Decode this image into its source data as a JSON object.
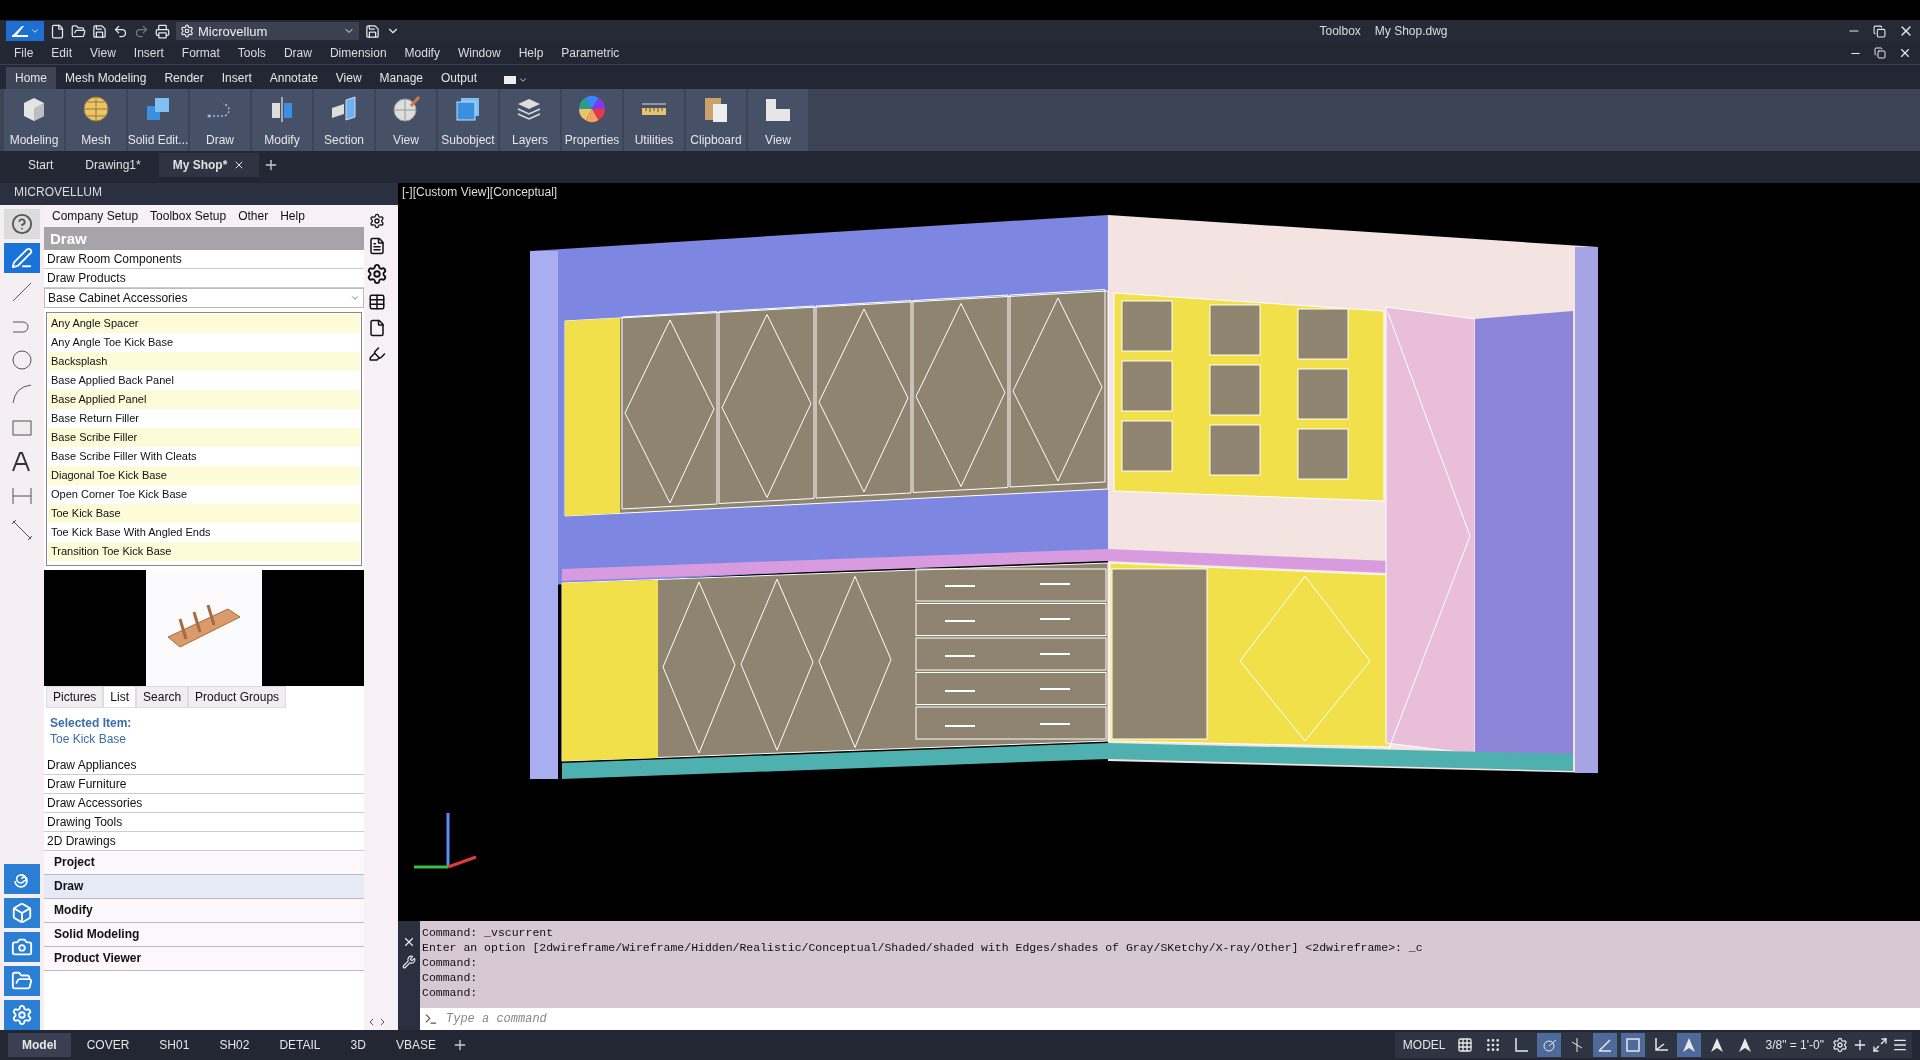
{
  "quick_access": {
    "workspace": "Microvellum"
  },
  "title_bar": {
    "items": [
      "Toolbox",
      "My Shop.dwg"
    ]
  },
  "menu_bar": [
    "File",
    "Edit",
    "View",
    "Insert",
    "Format",
    "Tools",
    "Draw",
    "Dimension",
    "Modify",
    "Window",
    "Help",
    "Parametric"
  ],
  "ribbon_tabs": [
    {
      "label": "Home",
      "selected": true
    },
    {
      "label": "Mesh Modeling",
      "selected": false
    },
    {
      "label": "Render",
      "selected": false
    },
    {
      "label": "Insert",
      "selected": false
    },
    {
      "label": "Annotate",
      "selected": false
    },
    {
      "label": "View",
      "selected": false
    },
    {
      "label": "Manage",
      "selected": false
    },
    {
      "label": "Output",
      "selected": false
    }
  ],
  "ribbon_buttons": [
    {
      "label": "Modeling",
      "kind": "box"
    },
    {
      "label": "Mesh",
      "kind": "sphere"
    },
    {
      "label": "Solid Edit...",
      "kind": "solids"
    },
    {
      "label": "Draw",
      "kind": "curve"
    },
    {
      "label": "Modify",
      "kind": "mirror"
    },
    {
      "label": "Section",
      "kind": "section"
    },
    {
      "label": "View",
      "kind": "globe"
    },
    {
      "label": "Subobject",
      "kind": "cube"
    },
    {
      "label": "Layers",
      "kind": "layers"
    },
    {
      "label": "Properties",
      "kind": "wheel"
    },
    {
      "label": "Utilities",
      "kind": "ruler"
    },
    {
      "label": "Clipboard",
      "kind": "clipboard"
    },
    {
      "label": "View",
      "kind": "lshape"
    }
  ],
  "file_tabs": [
    {
      "label": "Start",
      "selected": false
    },
    {
      "label": "Drawing1*",
      "selected": false
    },
    {
      "label": "My Shop*",
      "selected": true
    }
  ],
  "palette": {
    "title": "MICROVELLUM",
    "menu": [
      "Company Setup",
      "Toolbox Setup",
      "Other",
      "Help"
    ],
    "section_title": "Draw",
    "links": [
      "Draw Room Components",
      "Draw Products"
    ],
    "category": "Base Cabinet Accessories",
    "items": [
      "Any Angle Spacer",
      "Any Angle Toe Kick Base",
      "Backsplash",
      "Base Applied Back Panel",
      "Base Applied Panel",
      "Base Return Filler",
      "Base Scribe Filler",
      "Base Scribe Filler With Cleats",
      "Diagonal Toe Kick Base",
      "Open Corner Toe Kick Base",
      "Toe Kick Base",
      "Toe Kick Base With Angled Ends",
      "Transition Toe Kick Base"
    ],
    "view_tabs": [
      {
        "label": "Pictures",
        "selected": false
      },
      {
        "label": "List",
        "selected": true
      },
      {
        "label": "Search",
        "selected": false
      },
      {
        "label": "Product Groups",
        "selected": false
      }
    ],
    "selected_label": "Selected Item:",
    "selected_value": "Toe Kick Base",
    "more_links": [
      "Draw Appliances",
      "Draw Furniture",
      "Draw Accessories",
      "Drawing Tools",
      "2D Drawings"
    ],
    "sections": [
      {
        "label": "Project",
        "selected": false
      },
      {
        "label": "Draw",
        "selected": true
      },
      {
        "label": "Modify",
        "selected": false
      },
      {
        "label": "Solid Modeling",
        "selected": false
      },
      {
        "label": "Product Viewer",
        "selected": false
      }
    ]
  },
  "viewport": {
    "label": "[-][Custom View][Conceptual]"
  },
  "command_history": [
    "Command: _vscurrent",
    "Enter an option [2dwireframe/Wireframe/Hidden/Realistic/Conceptual/Shaded/shaded with Edges/shades of Gray/SKetchy/X-ray/Other] <2dwireframe>: _c",
    "Command:",
    "Command:",
    "Command:"
  ],
  "command_input": {
    "placeholder": "Type a command"
  },
  "layout_tabs": [
    {
      "label": "Model",
      "selected": true
    },
    {
      "label": "COVER",
      "selected": false
    },
    {
      "label": "SH01",
      "selected": false
    },
    {
      "label": "SH02",
      "selected": false
    },
    {
      "label": "DETAIL",
      "selected": false
    },
    {
      "label": "3D",
      "selected": false
    },
    {
      "label": "VBASE",
      "selected": false
    }
  ],
  "status_bar": {
    "space": "MODEL",
    "scale": "3/8\" = 1'-0\"",
    "toggles": [
      {
        "kind": "grid",
        "on": false
      },
      {
        "kind": "snap",
        "on": false
      },
      {
        "kind": "ortho",
        "on": false
      },
      {
        "kind": "polar",
        "on": true
      },
      {
        "kind": "isodraft",
        "on": false
      },
      {
        "kind": "otrack",
        "on": true
      },
      {
        "kind": "osnap",
        "on": true
      },
      {
        "kind": "ucs",
        "on": false
      },
      {
        "kind": "annovis",
        "on": true
      },
      {
        "kind": "autoscale",
        "on": false
      },
      {
        "kind": "annoscale",
        "on": false
      }
    ]
  }
}
